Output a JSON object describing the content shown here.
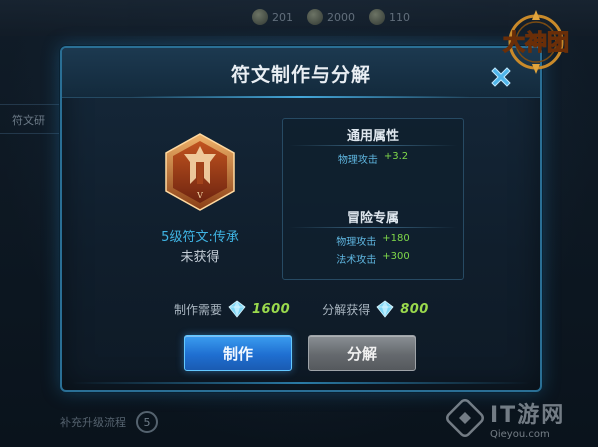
{
  "background": {
    "side_label": "符文研",
    "bottom_text": "补充升级流程",
    "bottom_badge": "5",
    "top_stats": [
      "201",
      "2000",
      "110"
    ]
  },
  "dialog": {
    "title": "符文制作与分解"
  },
  "rune": {
    "name": "5级符文:传承",
    "status": "未获得",
    "level_mark": "V"
  },
  "attributes": {
    "general": {
      "title": "通用属性",
      "rows": [
        {
          "name": "物理攻击",
          "value": "+3.2"
        }
      ]
    },
    "adventure": {
      "title": "冒险专属",
      "rows": [
        {
          "name": "物理攻击",
          "value": "+180"
        },
        {
          "name": "法术攻击",
          "value": "+300"
        }
      ]
    }
  },
  "cost": {
    "make_label": "制作需要",
    "make_value": "1600",
    "decompose_label": "分解获得",
    "decompose_value": "800"
  },
  "buttons": {
    "make": "制作",
    "decompose": "分解"
  },
  "brand": {
    "logo_text": "大神团"
  },
  "watermark": {
    "cn": "IT游网",
    "en": "Qieyou.com"
  },
  "colors": {
    "accent_blue": "#3fb4e3",
    "value_green": "#7fd84a",
    "frame_border": "#2a6f95",
    "button_blue": "#1f6fd1",
    "button_gray": "#65696e"
  },
  "icons": {
    "close": "close-x-icon",
    "crystal": "crystal-currency-icon",
    "rune": "rune-emblem-icon"
  }
}
